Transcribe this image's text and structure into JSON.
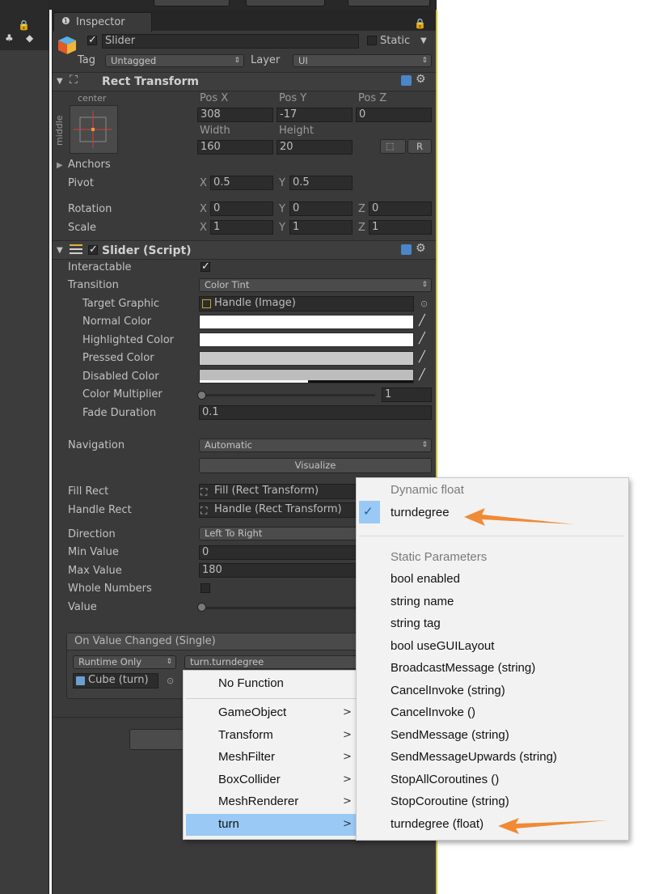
{
  "inspector": {
    "tab_title": "Inspector",
    "object_name": "Slider",
    "static_label": "Static",
    "tag_label": "Tag",
    "tag_value": "Untagged",
    "layer_label": "Layer",
    "layer_value": "UI"
  },
  "rect_transform": {
    "title": "Rect Transform",
    "anchor_h": "center",
    "anchor_v": "middle",
    "pos_x_label": "Pos X",
    "pos_y_label": "Pos Y",
    "pos_z_label": "Pos Z",
    "pos_x": "308",
    "pos_y": "-17",
    "pos_z": "0",
    "width_label": "Width",
    "height_label": "Height",
    "width": "160",
    "height": "20",
    "r_button": "R",
    "anchors_label": "Anchors",
    "pivot_label": "Pivot",
    "pivot_x": "0.5",
    "pivot_y": "0.5",
    "rotation_label": "Rotation",
    "rot_x": "0",
    "rot_y": "0",
    "rot_z": "0",
    "scale_label": "Scale",
    "scale_x": "1",
    "scale_y": "1",
    "scale_z": "1",
    "x": "X",
    "y": "Y",
    "z": "Z"
  },
  "slider_script": {
    "title": "Slider (Script)",
    "interactable_label": "Interactable",
    "transition_label": "Transition",
    "transition_value": "Color Tint",
    "target_graphic_label": "Target Graphic",
    "target_graphic_value": "Handle (Image)",
    "normal_color_label": "Normal Color",
    "highlighted_color_label": "Highlighted Color",
    "pressed_color_label": "Pressed Color",
    "disabled_color_label": "Disabled Color",
    "color_multiplier_label": "Color Multiplier",
    "color_multiplier_value": "1",
    "fade_duration_label": "Fade Duration",
    "fade_duration_value": "0.1",
    "navigation_label": "Navigation",
    "navigation_value": "Automatic",
    "visualize_label": "Visualize",
    "fill_rect_label": "Fill Rect",
    "fill_rect_value": "Fill (Rect Transform)",
    "handle_rect_label": "Handle Rect",
    "handle_rect_value": "Handle (Rect Transform)",
    "direction_label": "Direction",
    "direction_value": "Left To Right",
    "min_value_label": "Min Value",
    "min_value": "0",
    "max_value_label": "Max Value",
    "max_value": "180",
    "whole_numbers_label": "Whole Numbers",
    "value_label": "Value"
  },
  "event": {
    "title": "On Value Changed (Single)",
    "runtime_value": "Runtime Only",
    "function_value": "turn.turndegree",
    "object_value": "Cube (turn)"
  },
  "menu_left": {
    "no_function": "No Function",
    "items": [
      "GameObject",
      "Transform",
      "MeshFilter",
      "BoxCollider",
      "MeshRenderer",
      "turn"
    ],
    "chevron": ">"
  },
  "menu_right": {
    "dynamic_header": "Dynamic float",
    "dynamic_item": "turndegree",
    "static_header": "Static Parameters",
    "items": [
      "bool enabled",
      "string name",
      "string tag",
      "bool useGUILayout",
      "BroadcastMessage (string)",
      "CancelInvoke (string)",
      "CancelInvoke ()",
      "SendMessage (string)",
      "SendMessageUpwards (string)",
      "StopAllCoroutines ()",
      "StopCoroutine (string)",
      "turndegree (float)"
    ]
  },
  "colors": {
    "panel_bg": "#3a3a3a",
    "menu_bg": "#f2f2f2",
    "menu_highlight": "#99c9f4",
    "arrow_accent": "#f08a34",
    "panel_edge": "#d4c23a"
  },
  "icons": {
    "info": "info-icon",
    "lock": "lock-icon",
    "cube": "cube-icon",
    "book": "help-book-icon",
    "gear": "gear-icon",
    "check": "checkmark-icon"
  }
}
